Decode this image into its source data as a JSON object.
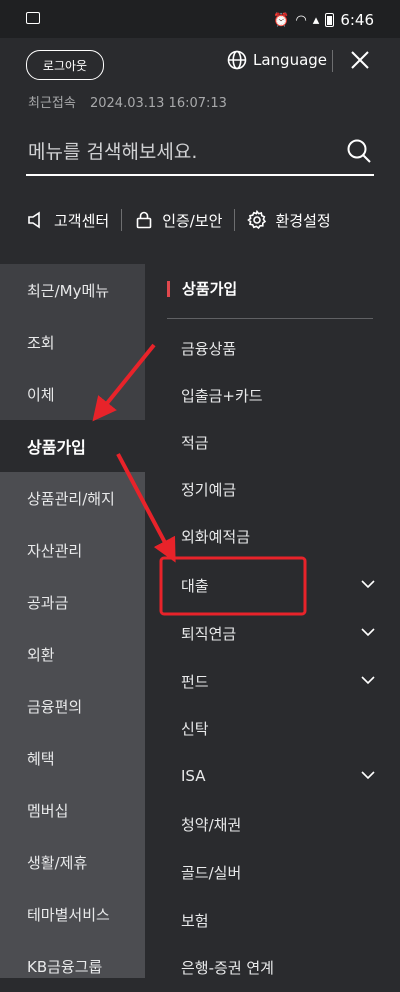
{
  "status_bar": {
    "time": "6:46"
  },
  "header": {
    "logout_label": "로그아웃",
    "language_label": "Language",
    "last_access_label": "최근접속",
    "last_access_time": "2024.03.13 16:07:13",
    "search_placeholder": "메뉴를 검색해보세요."
  },
  "quick_links": [
    {
      "label": "고객센터",
      "icon": "speaker-icon"
    },
    {
      "label": "인증/보안",
      "icon": "lock-icon"
    },
    {
      "label": "환경설정",
      "icon": "gear-icon"
    }
  ],
  "left_nav": {
    "items": [
      {
        "label": "최근/My메뉴"
      },
      {
        "label": "조회"
      },
      {
        "label": "이체"
      },
      {
        "label": "상품가입"
      },
      {
        "label": "상품관리/해지"
      },
      {
        "label": "자산관리"
      },
      {
        "label": "공과금"
      },
      {
        "label": "외환"
      },
      {
        "label": "금융편의"
      },
      {
        "label": "혜택"
      },
      {
        "label": "멤버십"
      },
      {
        "label": "생활/제휴"
      },
      {
        "label": "테마별서비스"
      },
      {
        "label": "KB금융그룹"
      }
    ]
  },
  "right_panel": {
    "title": "상품가입",
    "items": [
      {
        "label": "금융상품"
      },
      {
        "label": "입출금+카드"
      },
      {
        "label": "적금"
      },
      {
        "label": "정기예금"
      },
      {
        "label": "외화예적금"
      },
      {
        "label": "대출",
        "expandable": true
      },
      {
        "label": "퇴직연금",
        "expandable": true
      },
      {
        "label": "펀드",
        "expandable": true
      },
      {
        "label": "신탁"
      },
      {
        "label": "ISA",
        "expandable": true
      },
      {
        "label": "청약/채권"
      },
      {
        "label": "골드/실버"
      },
      {
        "label": "보험"
      },
      {
        "label": "은행-증권 연계"
      }
    ]
  },
  "annotation_color": "#e8232a"
}
